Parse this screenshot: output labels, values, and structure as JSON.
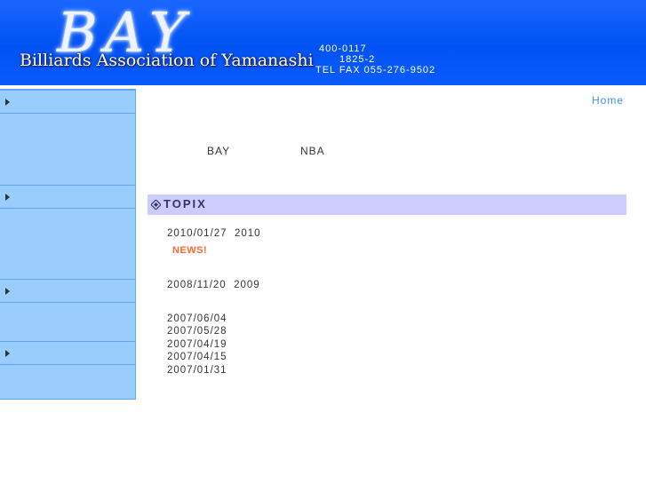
{
  "header": {
    "logo_main": "BAY",
    "logo_sub": "Billiards Association of Yamanashi",
    "postal": "400-0117",
    "street": "1825-2",
    "tel_fax": "TEL FAX 055-276-9502",
    "background_color": "#0052f2"
  },
  "sidebar": {
    "items": [
      {
        "label": ""
      },
      {
        "label": ""
      },
      {
        "label": ""
      },
      {
        "label": ""
      }
    ],
    "background_color": "#99ccff",
    "border_color": "#5fa9f5"
  },
  "nav": {
    "home_label": "Home",
    "link_color": "#3a8ee6"
  },
  "intro": {
    "left_text": "BAY",
    "right_text": "NBA"
  },
  "topix": {
    "title": "TOPIX",
    "icon": "diamond-bullet-icon",
    "bar_color": "#ccccff",
    "news_badge": "NEWS!",
    "news_badge_color": "#ff6633",
    "entries": [
      {
        "date": "2010/01/27",
        "text": "2010"
      },
      {
        "date": "2008/11/20",
        "text": "2009"
      },
      {
        "date": "2007/06/04",
        "text": ""
      },
      {
        "date": "2007/05/28",
        "text": ""
      },
      {
        "date": "2007/04/19",
        "text": ""
      },
      {
        "date": "2007/04/15",
        "text": ""
      },
      {
        "date": "2007/01/31",
        "text": ""
      }
    ]
  }
}
